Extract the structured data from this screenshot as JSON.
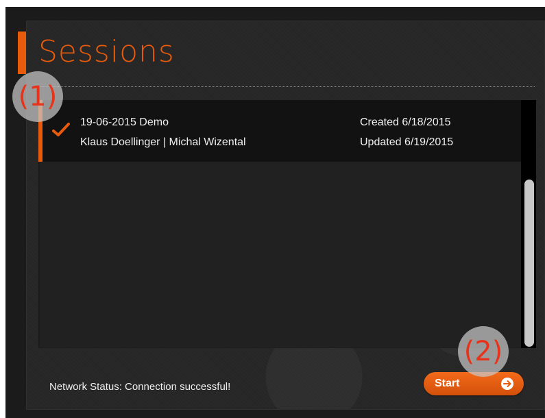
{
  "header": {
    "title": "Sessions"
  },
  "sessions": [
    {
      "name": "19-06-2015 Demo",
      "participants": "Klaus Doellinger | Michal Wizental",
      "created": "Created 6/18/2015",
      "updated": "Updated 6/19/2015",
      "selected": true
    }
  ],
  "footer": {
    "network_status": "Network Status: Connection successful!",
    "start_label": "Start"
  },
  "callouts": [
    "(1)",
    "(2)"
  ],
  "icons": {
    "selected": "check-icon",
    "start": "arrow-right-circle-icon"
  },
  "colors": {
    "accent": "#e85b0c",
    "background": "#262626",
    "selected_row": "#121212",
    "callout_text": "#e8331a"
  }
}
